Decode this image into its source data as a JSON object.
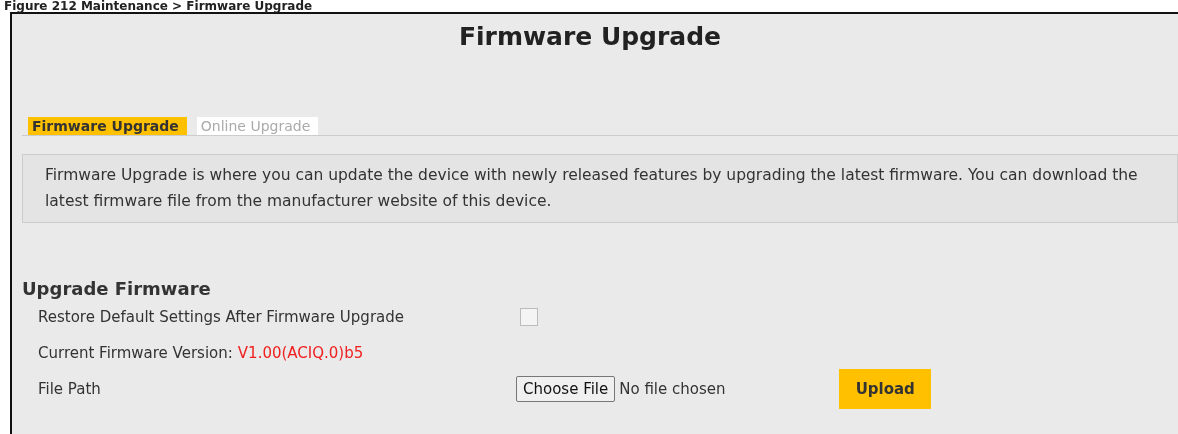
{
  "caption": "Figure 212   Maintenance > Firmware Upgrade",
  "title": "Firmware Upgrade",
  "tabs": [
    {
      "label": "Firmware Upgrade",
      "selected": true
    },
    {
      "label": "Online Upgrade",
      "selected": false
    }
  ],
  "info": "Firmware Upgrade is where you can update the device with newly released features by upgrading the latest firmware. You can download the latest firmware file from the manufacturer website of this device.",
  "section": {
    "heading": "Upgrade Firmware",
    "restore": {
      "label": "Restore Default Settings After Firmware Upgrade",
      "checked": false
    },
    "version": {
      "label": "Current Firmware Version:",
      "value": "V1.00(ACIQ.0)b5"
    },
    "file": {
      "label": "File Path",
      "button": "Choose File",
      "status": "No file chosen",
      "upload": "Upload"
    }
  }
}
